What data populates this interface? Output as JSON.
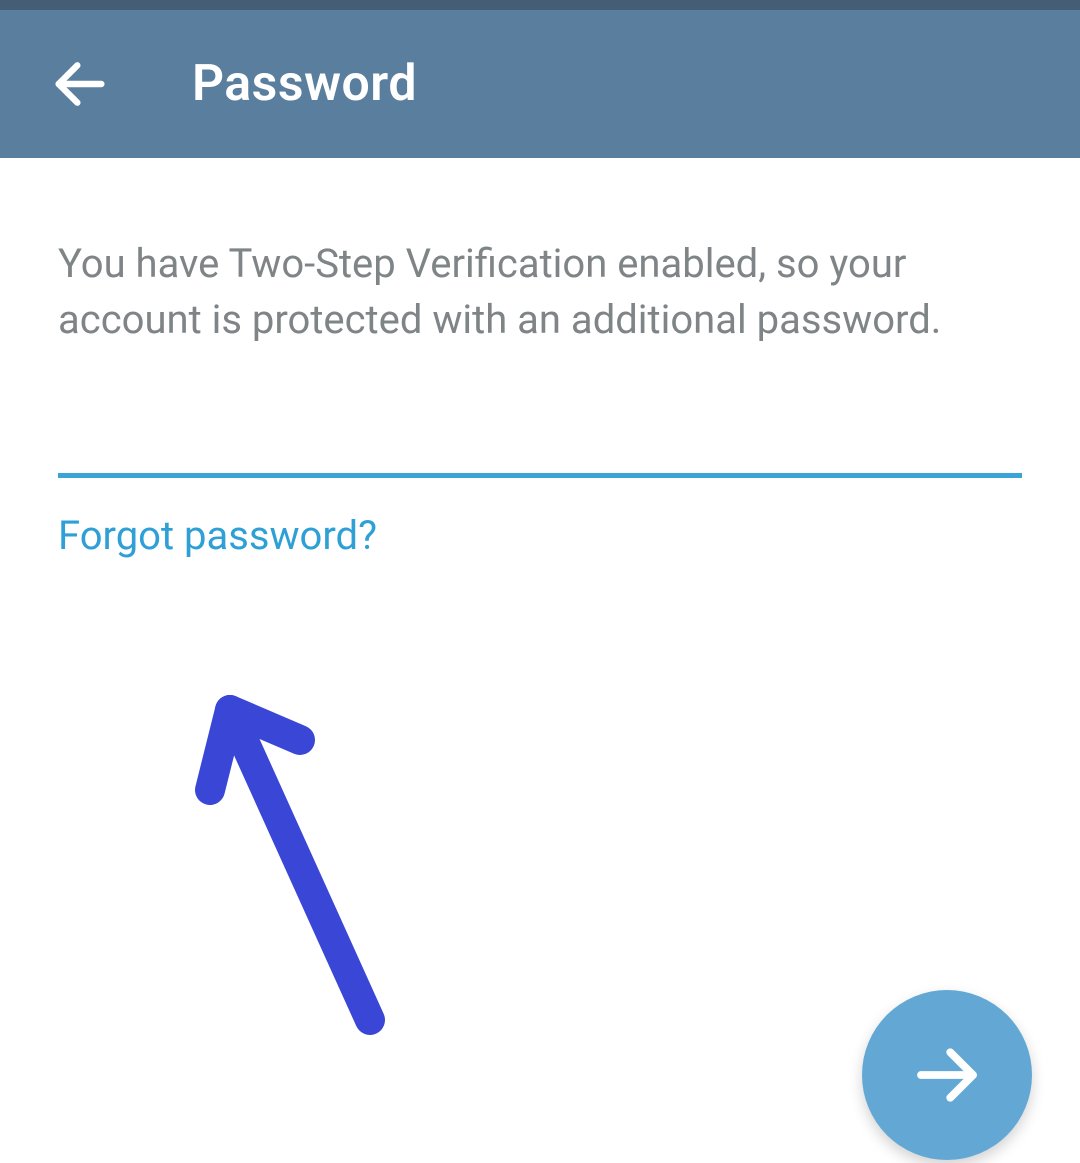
{
  "header": {
    "title": "Password"
  },
  "main": {
    "description": "You have Two-Step Verification enabled, so your account is protected with an additional password.",
    "password_value": "",
    "forgot_label": "Forgot password?"
  },
  "colors": {
    "appbar": "#5a7e9e",
    "accent": "#3aa4d9",
    "link": "#2ea0d6",
    "fab": "#63a8d4",
    "annotation": "#3a46d6"
  },
  "icons": {
    "back": "arrow-left",
    "fab": "arrow-right"
  }
}
